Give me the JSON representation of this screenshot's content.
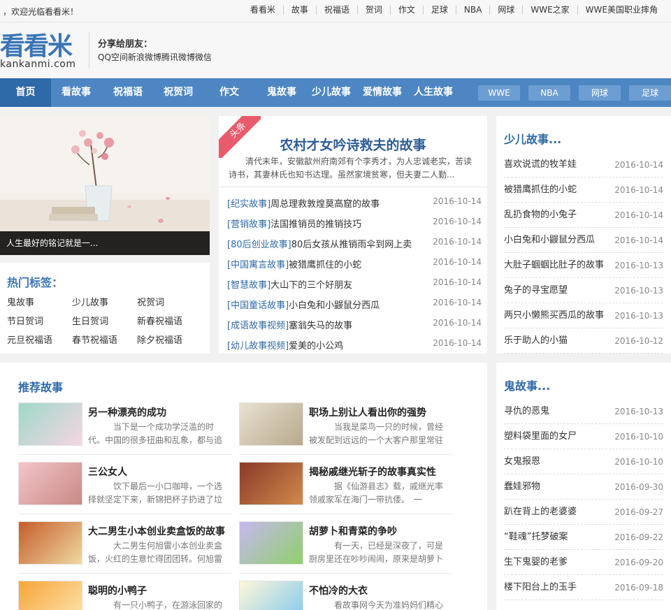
{
  "topbar": {
    "welcome": "，欢迎光临看看米！",
    "links": [
      "看看米",
      "故事",
      "祝福语",
      "贺词",
      "作文",
      "足球",
      "NBA",
      "网球",
      "WWE之家",
      "WWE美国职业摔角"
    ]
  },
  "header": {
    "logo_main": "看看米",
    "logo_sub": "kankanmi.com",
    "share_title": "分享给朋友：",
    "share_links": "QQ空间新浪微博腾讯微博微信"
  },
  "nav": {
    "items": [
      "首页",
      "看故事",
      "祝福语",
      "祝贺词",
      "作文",
      "鬼故事",
      "少儿故事",
      "爱情故事",
      "人生故事"
    ],
    "pills": [
      "WWE",
      "NBA",
      "网球",
      "足球"
    ]
  },
  "slide": {
    "caption": "人生最好的铭记就是一..."
  },
  "tags": {
    "title": "热门标签：",
    "items": [
      "鬼故事",
      "少儿故事",
      "祝贺词",
      "节日贺词",
      "生日贺词",
      "新春祝福语",
      "元旦祝福语",
      "春节祝福语",
      "除夕祝福语"
    ]
  },
  "headline": {
    "ribbon": "头条",
    "title": "农村才女吟诗救夫的故事",
    "desc": "清代末年，安徽歙州府南郊有个李秀才，为人忠诚老实，苦读诗书，其妻林氏也知书达理。虽然家境贫寒，但夫妻二人勤...",
    "news": [
      {
        "cat": "[纪实故事]",
        "title": "周总理救敦煌莫高窟的故事",
        "date": "2016-10-14"
      },
      {
        "cat": "[营销故事]",
        "title": "法国推销员的推销技巧",
        "date": "2016-10-14"
      },
      {
        "cat": "[80后创业故事]",
        "title": "80后女孩从推销雨伞到网上卖",
        "date": "2016-10-14"
      },
      {
        "cat": "[中国寓言故事]",
        "title": "被猎鹰抓住的小蛇",
        "date": "2016-10-14"
      },
      {
        "cat": "[智慧故事]",
        "title": "大山下的三个好朋友",
        "date": "2016-10-14"
      },
      {
        "cat": "[中国童话故事]",
        "title": "小白兔和小鼹鼠分西瓜",
        "date": "2016-10-14"
      },
      {
        "cat": "[成语故事视频]",
        "title": "塞翁失马的故事",
        "date": "2016-10-14"
      },
      {
        "cat": "[幼儿故事视频]",
        "title": "爱美的小公鸡",
        "date": "2016-10-14"
      }
    ]
  },
  "kids": {
    "title": "少儿故事...",
    "items": [
      {
        "title": "喜欢说谎的牧羊娃",
        "date": "2016-10-14"
      },
      {
        "title": "被猎鹰抓住的小蛇",
        "date": "2016-10-14"
      },
      {
        "title": "乱扔食物的小兔子",
        "date": "2016-10-14"
      },
      {
        "title": "小白兔和小鼹鼠分西瓜",
        "date": "2016-10-14"
      },
      {
        "title": "大肚子蝈蝈比肚子的故事",
        "date": "2016-10-13"
      },
      {
        "title": "兔子的寻宝愿望",
        "date": "2016-10-13"
      },
      {
        "title": "两只小懒熊买西瓜的故事",
        "date": "2016-10-13"
      },
      {
        "title": "乐于助人的小猫",
        "date": "2016-10-12"
      }
    ]
  },
  "recommend": {
    "title": "推荐故事",
    "items": [
      {
        "name": "另一种漂亮的成功",
        "desc": "当下是一个成功学泛滥的时代。中国的很多扭曲和乱象，都与追",
        "thumb": "girl-cartoon",
        "c1": "#9fd8c8",
        "c2": "#f5d6e3"
      },
      {
        "name": "职场上别让人看出你的强势",
        "desc": "当我是菜鸟一只的时候，曾经被发配到远远的一个大客户那里常驻",
        "thumb": "village-sketch",
        "c1": "#e9e1d2",
        "c2": "#b7a98c"
      },
      {
        "name": "三公女人",
        "desc": "饮下最后一小口咖啡，一个选择就坚定下来，新锦把杯子扔进了垃",
        "thumb": "flowers",
        "c1": "#f3c5c9",
        "c2": "#c98a86"
      },
      {
        "name": "揭秘戚继光斩子的故事真实性",
        "desc": "据《仙游县志》载，戚继光率领戚家军在海门一带抗倭。　一",
        "thumb": "warriors",
        "c1": "#8a3a2a",
        "c2": "#d08a4a"
      },
      {
        "name": "大二男生小本创业卖盒饭的故事",
        "desc": "大二男生何旭雷小本创业卖盒饭，火红的生意忙得团团转。何旭雷",
        "thumb": "food",
        "c1": "#c65d2a",
        "c2": "#f0d9a2"
      },
      {
        "name": "胡萝卜和青菜的争吵",
        "desc": "有一天，已经是深夜了，可是厨房里还在吵吵闹闹，原来是胡萝卜",
        "thumb": "carrot",
        "c1": "#c7b8f0",
        "c2": "#8fd06a"
      },
      {
        "name": "聪明的小鸭子",
        "desc": "有一只小鸭子，在游泳回家的",
        "thumb": "fox",
        "c1": "#f7a53a",
        "c2": "#fde6b0"
      },
      {
        "name": "不怕冷的大衣",
        "desc": "看故事网今天为准妈妈们精心",
        "thumb": "rabbit",
        "c1": "#fff7d8",
        "c2": "#7fc8ef"
      }
    ]
  },
  "ghost": {
    "title": "鬼故事...",
    "items": [
      {
        "title": "寻仇的恶鬼",
        "date": "2016-10-13"
      },
      {
        "title": "塑料袋里面的女尸",
        "date": "2016-10-10"
      },
      {
        "title": "女鬼报恩",
        "date": "2016-10-10"
      },
      {
        "title": "蠢娃邪物",
        "date": "2016-09-30"
      },
      {
        "title": "趴在背上的老婆婆",
        "date": "2016-09-27"
      },
      {
        "title": "“鞋魂”托梦破案",
        "date": "2016-09-22"
      },
      {
        "title": "生下鬼婴的老爹",
        "date": "2016-09-20"
      },
      {
        "title": "楼下阳台上的玉手",
        "date": "2016-09-18"
      }
    ]
  },
  "colors": {
    "brand": "#3b75b6",
    "nav": "#4d86c2",
    "nav_active": "#2f6aa8",
    "ribbon": "#e85a6c"
  }
}
